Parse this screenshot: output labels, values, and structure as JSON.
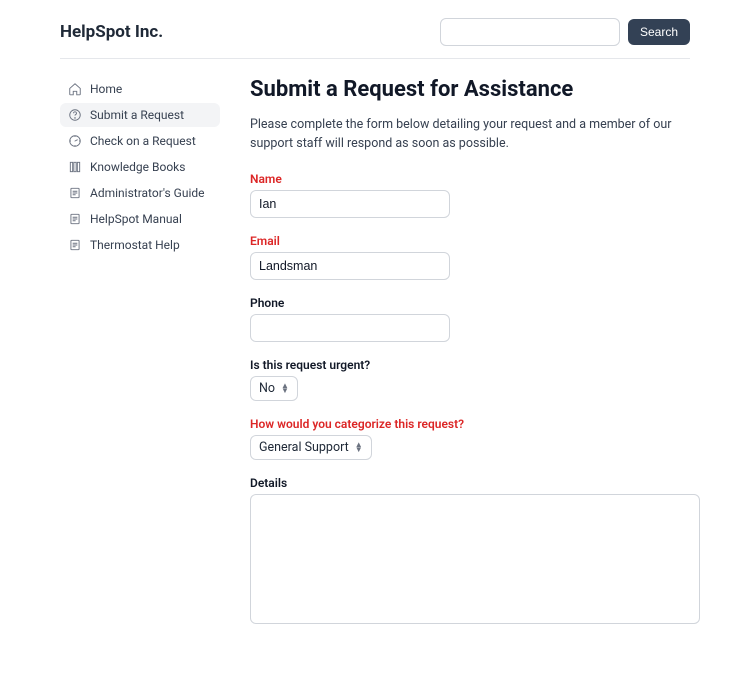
{
  "header": {
    "brand": "HelpSpot Inc.",
    "searchBtn": "Search"
  },
  "sidebar": {
    "items": [
      {
        "label": "Home",
        "icon": "home-icon"
      },
      {
        "label": "Submit a Request",
        "icon": "help-icon"
      },
      {
        "label": "Check on a Request",
        "icon": "clock-icon"
      },
      {
        "label": "Knowledge Books",
        "icon": "books-icon"
      },
      {
        "label": "Administrator's Guide",
        "icon": "doc-icon"
      },
      {
        "label": "HelpSpot Manual",
        "icon": "doc-icon"
      },
      {
        "label": "Thermostat Help",
        "icon": "doc-icon"
      }
    ],
    "activeIndex": 1
  },
  "page": {
    "title": "Submit a Request for Assistance",
    "intro": "Please complete the form below detailing your request and a member of our support staff will respond as soon as possible."
  },
  "form": {
    "nameLabel": "Name",
    "nameValue": "Ian",
    "emailLabel": "Email",
    "emailValue": "Landsman",
    "phoneLabel": "Phone",
    "phoneValue": "",
    "urgentLabel": "Is this request urgent?",
    "urgentValue": "No",
    "categoryLabel": "How would you categorize this request?",
    "categoryValue": "General Support",
    "detailsLabel": "Details",
    "detailsValue": ""
  }
}
